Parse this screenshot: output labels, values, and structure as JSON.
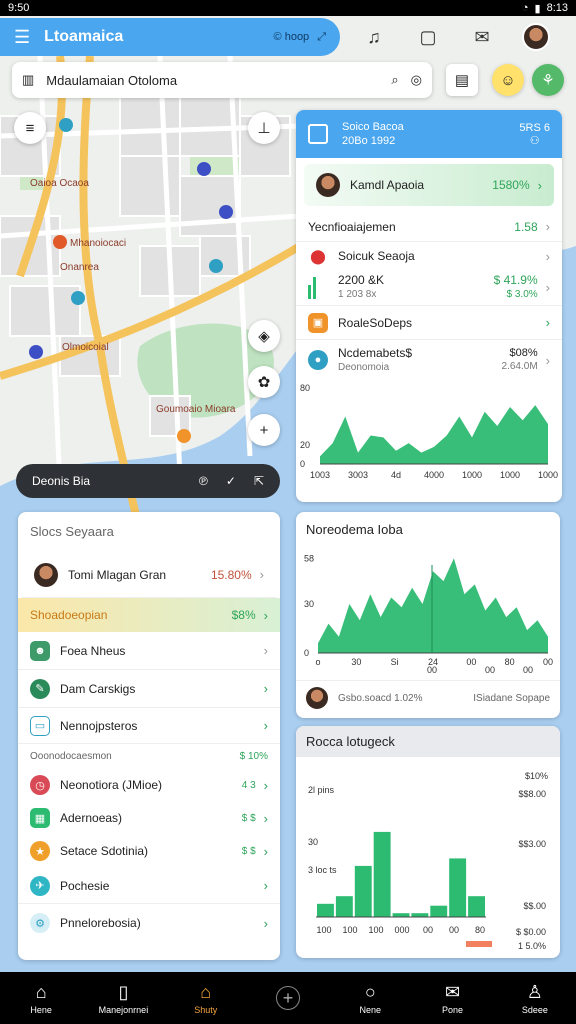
{
  "status": {
    "time": "9:50",
    "right_time": "8:13"
  },
  "appbar": {
    "title": "Ltoamaica",
    "chip": "© hoop",
    "chip2": "⤢"
  },
  "search": {
    "text": "Mdaulamaian Otoloma"
  },
  "map_labels": [
    "Oaioa Ocaoa",
    "Mhanoiocaci",
    "Onanrea",
    "Olmoicoial",
    "Goumoaio Mioara"
  ],
  "darkbar": {
    "label": "Deonis Bia"
  },
  "right_panel": {
    "header_line1": "Soico Bacoa",
    "header_line2": "20Bo 1992",
    "header_right": "5RS 6",
    "highlight": {
      "name": "Kamdl Apaoia",
      "value": "1580%"
    },
    "rows": [
      {
        "label": "Yecnfioaiajemen",
        "value": "1.58"
      },
      {
        "label": "Soicuk Seaoja",
        "value": ""
      },
      {
        "label": "2200 &K",
        "sub": "1 203 8x",
        "value": "$ 41.9%",
        "value2": "$ 3.0%"
      },
      {
        "label": "RoaleSoDeps",
        "value": ""
      },
      {
        "label": "Ncdemabets$",
        "sub": "Deonomoia",
        "value": "$08%",
        "value2": "2.64.0M"
      }
    ],
    "chart": {
      "y_labels": [
        "80",
        "20",
        "0"
      ],
      "x_labels": [
        "1003",
        "3003",
        "4d",
        "4000",
        "1000",
        "1000",
        "1000"
      ]
    }
  },
  "left_list": {
    "title": "Slocs Seyaara",
    "items": [
      {
        "label": "Tomi Mlagan Gran",
        "value": "15.80%"
      },
      {
        "label": "Shoadoeopian",
        "value": "$8%"
      },
      {
        "label": "Foea Nheus",
        "value": ""
      },
      {
        "label": "Dam Carskigs",
        "value": ""
      },
      {
        "label": "Nennojpsteros",
        "value": ""
      }
    ],
    "section": {
      "label": "Ooonodocaesmon",
      "value": "$ 10%"
    },
    "items2": [
      {
        "label": "Neonotiora (JMioe)",
        "value": "4 3"
      },
      {
        "label": "Adernoeas)",
        "value": "$ $"
      },
      {
        "label": "Setace Sdotinia)",
        "value": "$ $"
      },
      {
        "label": "Pochesie",
        "value": ""
      },
      {
        "label": "Pnnelorebosia)",
        "value": ""
      }
    ]
  },
  "mid_chart": {
    "title": "Noreodema Ioba",
    "y_labels": [
      "58",
      "30",
      "0"
    ],
    "x_labels": [
      "o",
      "30",
      "Si",
      "24",
      "00",
      "80",
      "00"
    ],
    "x_labels2": [
      "00",
      "00",
      "00"
    ],
    "footer_left": "Gsbo.soacd 1.02%",
    "footer_right": "ISiadane Sopape"
  },
  "bar_card": {
    "title": "Rocca lotugeck",
    "top_value": "$10%",
    "labels_left": [
      "2l pins",
      "30",
      "3 loc ts"
    ],
    "labels_right": [
      "$$8.00",
      "$$3.00",
      "$$.00"
    ],
    "x_labels": [
      "100",
      "100",
      "100",
      "000",
      "00",
      "00",
      "80"
    ],
    "footer_value": "$ $0.00",
    "footer_pct": "1 5.0%"
  },
  "chart_data": [
    {
      "type": "area",
      "title": "",
      "x": [
        "1003",
        "3003",
        "4d",
        "4000",
        "1000",
        "1000",
        "1000"
      ],
      "values": [
        8,
        22,
        50,
        12,
        30,
        28,
        14,
        22,
        12,
        18,
        30,
        50,
        28,
        55,
        40,
        60,
        46,
        62,
        42
      ],
      "ylim": [
        0,
        80
      ]
    },
    {
      "type": "area",
      "title": "Noreodema Ioba",
      "values": [
        6,
        18,
        10,
        30,
        20,
        36,
        22,
        34,
        28,
        40,
        30,
        50,
        44,
        58,
        36,
        42,
        26,
        34,
        22,
        28,
        14,
        20,
        10
      ],
      "ylim": [
        0,
        60
      ]
    },
    {
      "type": "bar",
      "title": "Rocca lotugeck",
      "categories": [
        "100",
        "100",
        "100",
        "000",
        "00",
        "00",
        "80"
      ],
      "values": [
        14,
        22,
        54,
        90,
        4,
        4,
        12,
        62,
        22
      ],
      "ylim": [
        0,
        110
      ]
    }
  ],
  "bottomnav": [
    {
      "label": "Hene",
      "icon": "home-icon"
    },
    {
      "label": "Manejonrnei",
      "icon": "tablet-icon"
    },
    {
      "label": "Shuty",
      "icon": "store-icon"
    },
    {
      "label": "",
      "icon": "plus-icon"
    },
    {
      "label": "Nene",
      "icon": "circle-icon"
    },
    {
      "label": "Pone",
      "icon": "mail-icon"
    },
    {
      "label": "Sdeee",
      "icon": "person-icon"
    }
  ],
  "colors": {
    "accent": "#4aa6ee",
    "chart_green": "#2dbb72",
    "nav_active": "#f2a33a"
  }
}
